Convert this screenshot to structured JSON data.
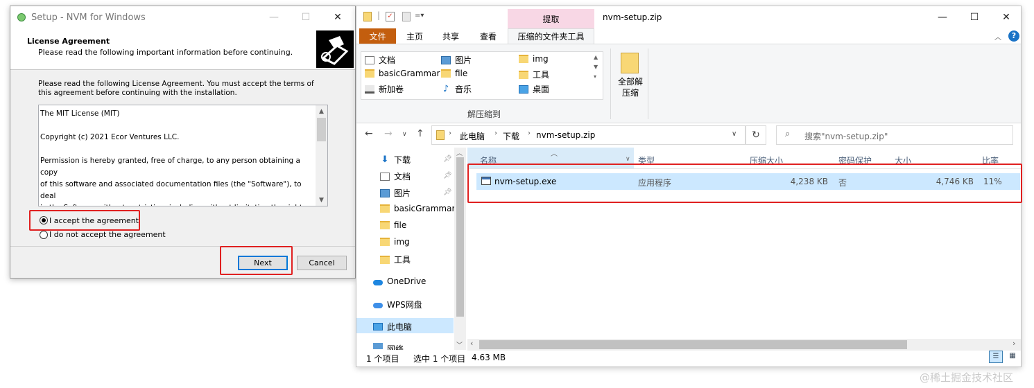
{
  "setup": {
    "title": "Setup - NVM for Windows",
    "header_title": "License Agreement",
    "header_subtitle": "Please read the following important information before continuing.",
    "intro": "Please read the following License Agreement. You must accept the terms of this agreement before continuing with the installation.",
    "license_text": "The MIT License (MIT)\n\nCopyright (c) 2021 Ecor Ventures LLC.\n\nPermission is hereby granted, free of charge, to any person obtaining a copy\nof this software and associated documentation files (the \"Software\"), to deal\nin the Software without restriction, including without limitation the rights\nto use, copy, modify, merge, publish, distribute, sublicense, and/or sell\ncopies of the Software, and to permit persons to whom the Software is",
    "radio_accept": "I accept the agreement",
    "radio_decline": "I do not accept the agreement",
    "accept_selected": true,
    "next_label": "Next",
    "cancel_label": "Cancel"
  },
  "explorer": {
    "window_title": "nvm-setup.zip",
    "context_tab_group": "提取",
    "tabs": [
      "文件",
      "主页",
      "共享",
      "查看",
      "压缩的文件夹工具"
    ],
    "ribbon_locations": [
      {
        "label": "文档",
        "icon": "document-icon"
      },
      {
        "label": "图片",
        "icon": "picture-icon"
      },
      {
        "label": "img",
        "icon": "folder-icon"
      },
      {
        "label": "basicGrammar",
        "icon": "folder-icon"
      },
      {
        "label": "file",
        "icon": "folder-icon"
      },
      {
        "label": "工具",
        "icon": "folder-icon"
      },
      {
        "label": "新加卷",
        "icon": "drive-icon"
      },
      {
        "label": "音乐",
        "icon": "music-icon"
      },
      {
        "label": "桌面",
        "icon": "desktop-icon"
      }
    ],
    "ribbon_group_label": "解压缩到",
    "extract_all_label": "全部解\n压缩",
    "breadcrumb": [
      "此电脑",
      "下载",
      "nvm-setup.zip"
    ],
    "search_placeholder": "搜索\"nvm-setup.zip\"",
    "nav_items": [
      {
        "label": "下载",
        "icon": "download-icon",
        "pinned": true
      },
      {
        "label": "文档",
        "icon": "document-icon",
        "pinned": true
      },
      {
        "label": "图片",
        "icon": "picture-icon",
        "pinned": true
      },
      {
        "label": "basicGrammar",
        "icon": "folder-icon"
      },
      {
        "label": "file",
        "icon": "folder-icon"
      },
      {
        "label": "img",
        "icon": "folder-icon"
      },
      {
        "label": "工具",
        "icon": "folder-icon"
      },
      {
        "label": "OneDrive",
        "icon": "onedrive-icon"
      },
      {
        "label": "WPS网盘",
        "icon": "wps-icon"
      },
      {
        "label": "此电脑",
        "icon": "pc-icon",
        "selected": true
      },
      {
        "label": "网络",
        "icon": "network-icon"
      }
    ],
    "columns": [
      "名称",
      "类型",
      "压缩大小",
      "密码保护",
      "大小",
      "比率"
    ],
    "files": [
      {
        "name": "nvm-setup.exe",
        "type": "应用程序",
        "compressed": "4,238 KB",
        "password": "否",
        "size": "4,746 KB",
        "ratio": "11%"
      }
    ],
    "status": {
      "count": "1 个项目",
      "selected": "选中 1 个项目",
      "size": "4.63 MB"
    }
  },
  "watermark": "@稀土掘金技术社区",
  "colors": {
    "highlight_box": "#e02020",
    "file_tab": "#c35e0e",
    "context_tab": "#f8d7e5",
    "selection": "#cce8ff"
  }
}
